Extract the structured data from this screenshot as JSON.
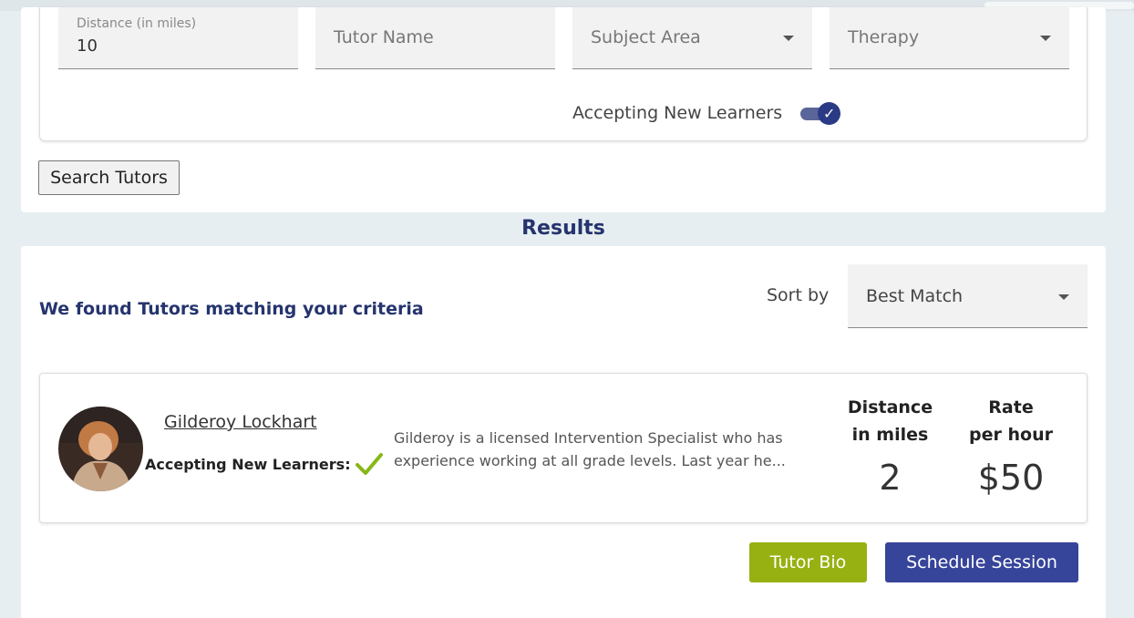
{
  "filters": {
    "distance": {
      "label": "Distance (in miles)",
      "value": "10"
    },
    "tutor_name": {
      "placeholder": "Tutor Name"
    },
    "subject_area": {
      "selected": "Subject Area"
    },
    "therapy": {
      "selected": "Therapy"
    },
    "accepting_toggle": {
      "label": "Accepting New Learners",
      "checked": true
    }
  },
  "search_button": "Search Tutors",
  "results": {
    "heading": "Results",
    "found_text": "We found Tutors matching your criteria",
    "sort": {
      "label": "Sort by",
      "selected": "Best Match"
    },
    "tutors": [
      {
        "name": "Gilderoy Lockhart",
        "accepting_label": "Accepting New Learners:",
        "bio": "Gilderoy is a licensed Intervention Specialist who has experience working at all grade levels. Last year he...",
        "distance_header": [
          "Distance",
          "in miles"
        ],
        "distance": "2",
        "rate_header": [
          "Rate",
          "per hour"
        ],
        "rate": "$50",
        "bio_button": "Tutor Bio",
        "schedule_button": "Schedule Session"
      }
    ]
  },
  "colors": {
    "page_bg": "#e7eef1",
    "heading_navy": "#25346e",
    "primary_button": "#36449a",
    "secondary_button": "#97b112",
    "check_green": "#86b817"
  }
}
